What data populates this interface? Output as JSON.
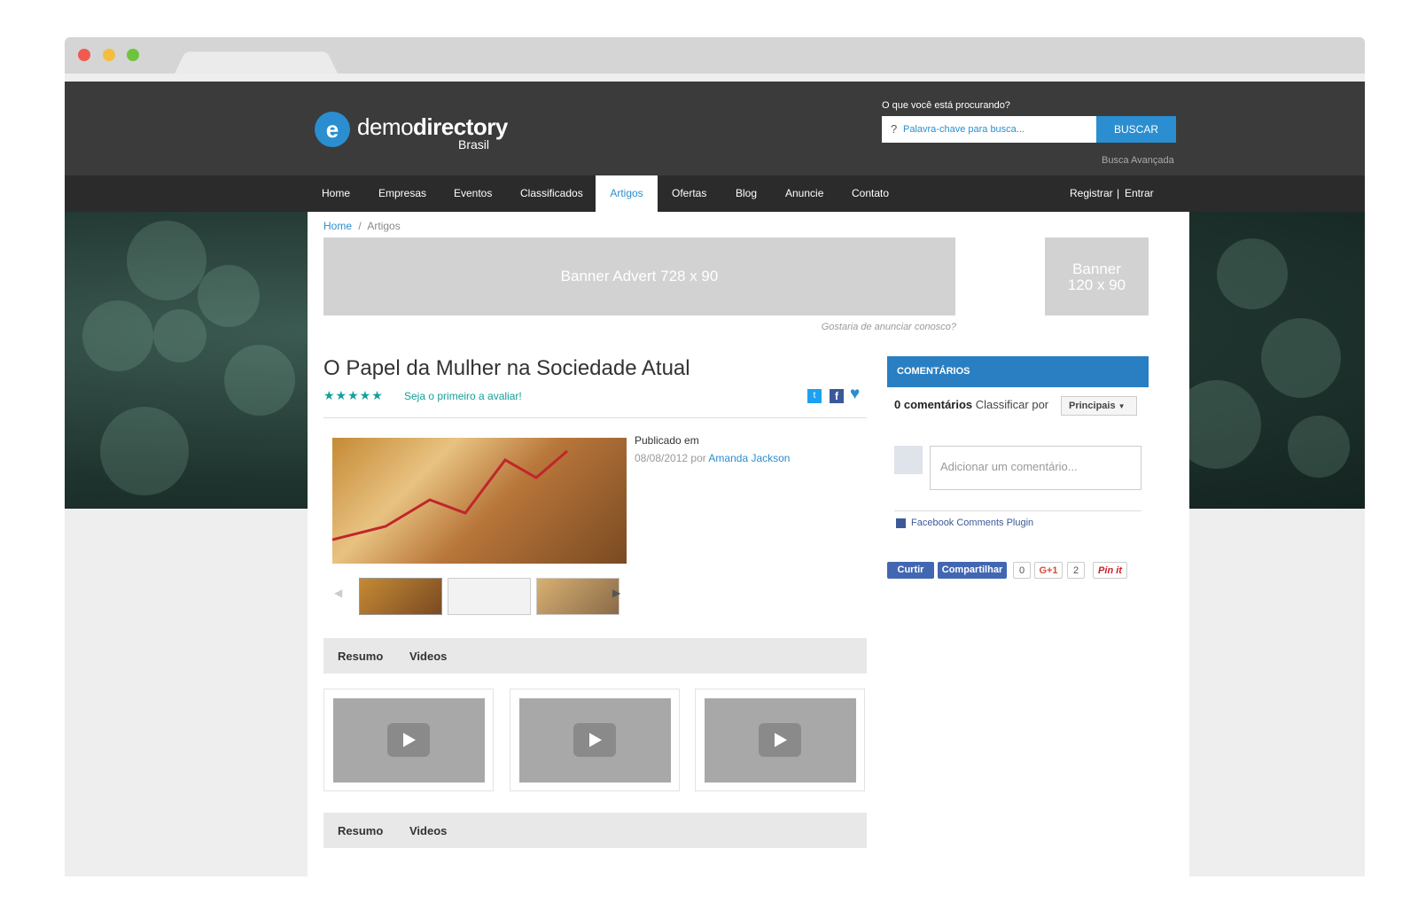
{
  "header": {
    "logo_letter": "e",
    "logo_light": "demo",
    "logo_bold": "directory",
    "logo_sub": "Brasil",
    "search_label": "O que você está procurando?",
    "search_placeholder": "Palavra-chave para busca...",
    "search_button": "BUSCAR",
    "advanced_search": "Busca Avançada"
  },
  "nav": {
    "items": [
      "Home",
      "Empresas",
      "Eventos",
      "Classificados",
      "Artigos",
      "Ofertas",
      "Blog",
      "Anuncie",
      "Contato"
    ],
    "active": "Artigos",
    "register": "Registrar",
    "separator": "|",
    "login": "Entrar"
  },
  "breadcrumb": {
    "home": "Home",
    "sep": "/",
    "current": "Artigos"
  },
  "banners": {
    "leaderboard": "Banner Advert 728 x 90",
    "small_line1": "Banner",
    "small_line2": "120 x 90",
    "advertise_link": "Gostaria de anunciar conosco?"
  },
  "article": {
    "title": "O Papel da Mulher na Sociedade Atual",
    "stars": "★★★★★",
    "rate_link": "Seja o primeiro a avaliar!",
    "published_label": "Publicado em",
    "date": "08/08/2012",
    "by": "por",
    "author": "Amanda Jackson"
  },
  "tabs": {
    "resumo": "Resumo",
    "videos": "Videos"
  },
  "comments": {
    "header": "COMENTÁRIOS",
    "count": "0 comentários",
    "sort_label": "Classificar por",
    "sort_value": "Principais",
    "placeholder": "Adicionar um comentário...",
    "plugin": "Facebook Comments Plugin"
  },
  "social": {
    "like": "Curtir",
    "share": "Compartilhar",
    "share_count": "0",
    "gplus": "G+1",
    "gplus_count": "2",
    "pin": "Pin it"
  },
  "colors": {
    "accent": "#2a8ed0",
    "header_bg": "#3b3b3b",
    "nav_bg": "#2b2b2b",
    "stars": "#14a09a"
  }
}
